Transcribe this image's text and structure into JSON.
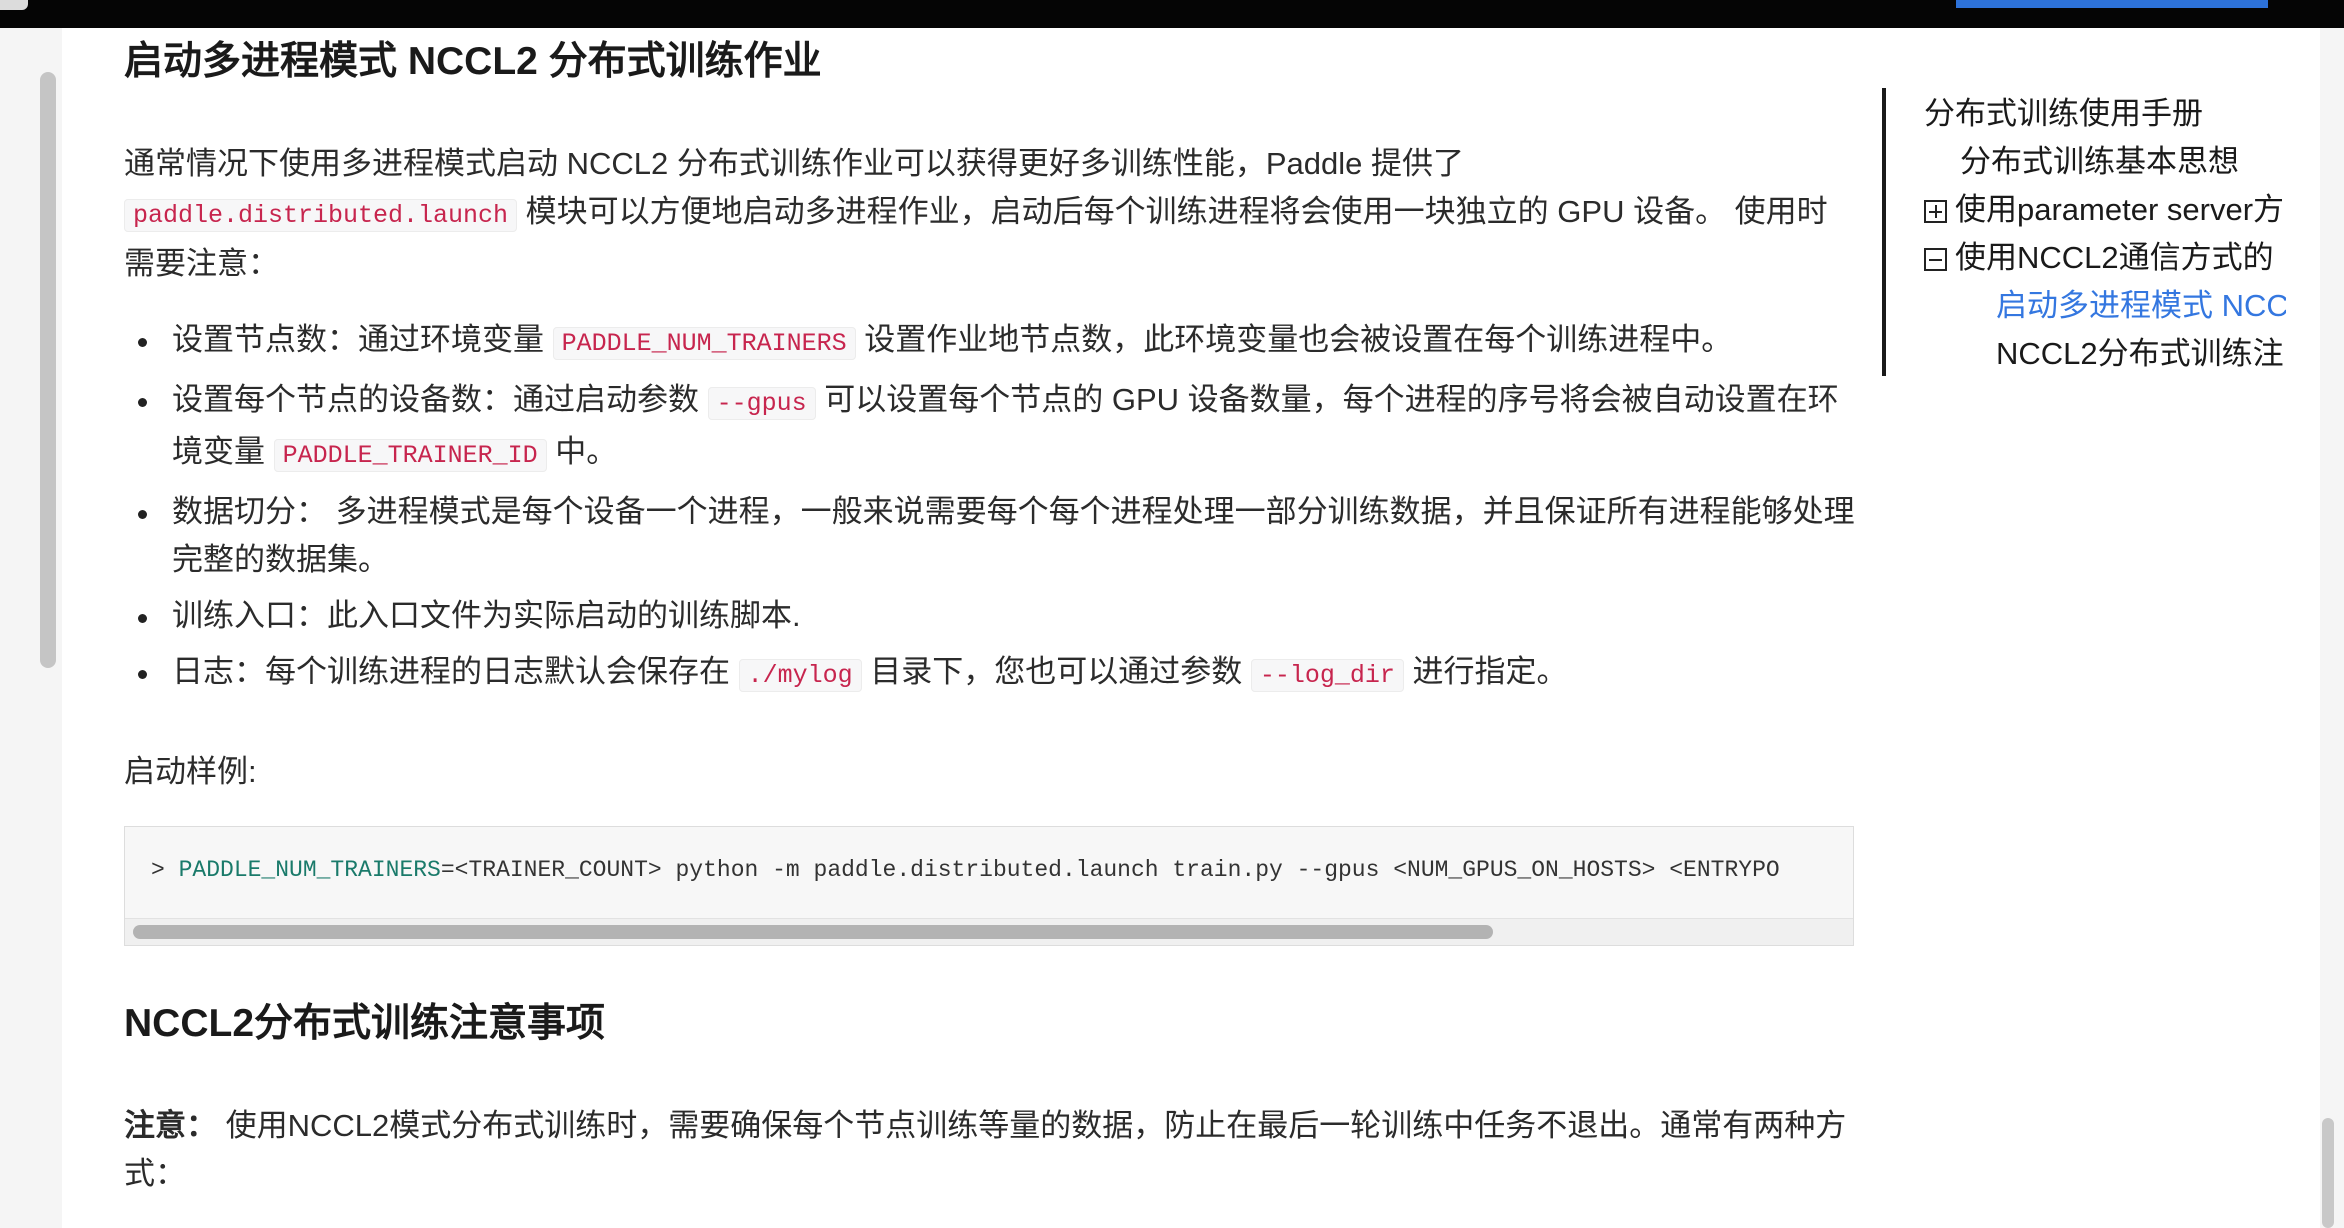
{
  "section1": {
    "heading": "启动多进程模式 NCCL2 分布式训练作业",
    "intro_part1": "通常情况下使用多进程模式启动 NCCL2 分布式训练作业可以获得更好多训练性能，Paddle 提供了",
    "intro_code": "paddle.distributed.launch",
    "intro_part2": " 模块可以方便地启动多进程作业，启动后每个训练进程将会使用一块独立的 GPU 设备。 使用时需要注意：",
    "bullets": [
      {
        "pre": "设置节点数：通过环境变量 ",
        "code": "PADDLE_NUM_TRAINERS",
        "post": " 设置作业地节点数，此环境变量也会被设置在每个训练进程中。"
      },
      {
        "pre": "设置每个节点的设备数：通过启动参数 ",
        "code": "--gpus",
        "mid": " 可以设置每个节点的 GPU 设备数量，每个进程的序号将会被自动设置在环境变量 ",
        "code2": "PADDLE_TRAINER_ID",
        "post": " 中。"
      },
      {
        "text": "数据切分： 多进程模式是每个设备一个进程，一般来说需要每个每个进程处理一部分训练数据，并且保证所有进程能够处理完整的数据集。"
      },
      {
        "text": "训练入口：此入口文件为实际启动的训练脚本."
      },
      {
        "pre": "日志：每个训练进程的日志默认会保存在 ",
        "code": "./mylog",
        "mid": " 目录下，您也可以通过参数 ",
        "code2": "--log_dir",
        "post": " 进行指定。"
      }
    ],
    "example_label": "启动样例:",
    "code_prompt": "> ",
    "code_var": "PADDLE_NUM_TRAINERS",
    "code_rest": "=<TRAINER_COUNT> python -m paddle.distributed.launch train.py --gpus <NUM_GPUS_ON_HOSTS> <ENTRYPO"
  },
  "section2": {
    "heading": "NCCL2分布式训练注意事项",
    "note_label": "注意：",
    "note_text": " 使用NCCL2模式分布式训练时，需要确保每个节点训练等量的数据，防止在最后一轮训练中任务不退出。通常有两种方式："
  },
  "toc": {
    "items": [
      "分布式训练使用手册",
      "分布式训练基本思想",
      "使用parameter server方",
      "使用NCCL2通信方式的",
      "启动多进程模式 NCCL",
      "NCCL2分布式训练注"
    ]
  },
  "colors": {
    "accent": "#3477e0",
    "inline_code": "#c7254e",
    "code_var": "#1a7a6a"
  }
}
